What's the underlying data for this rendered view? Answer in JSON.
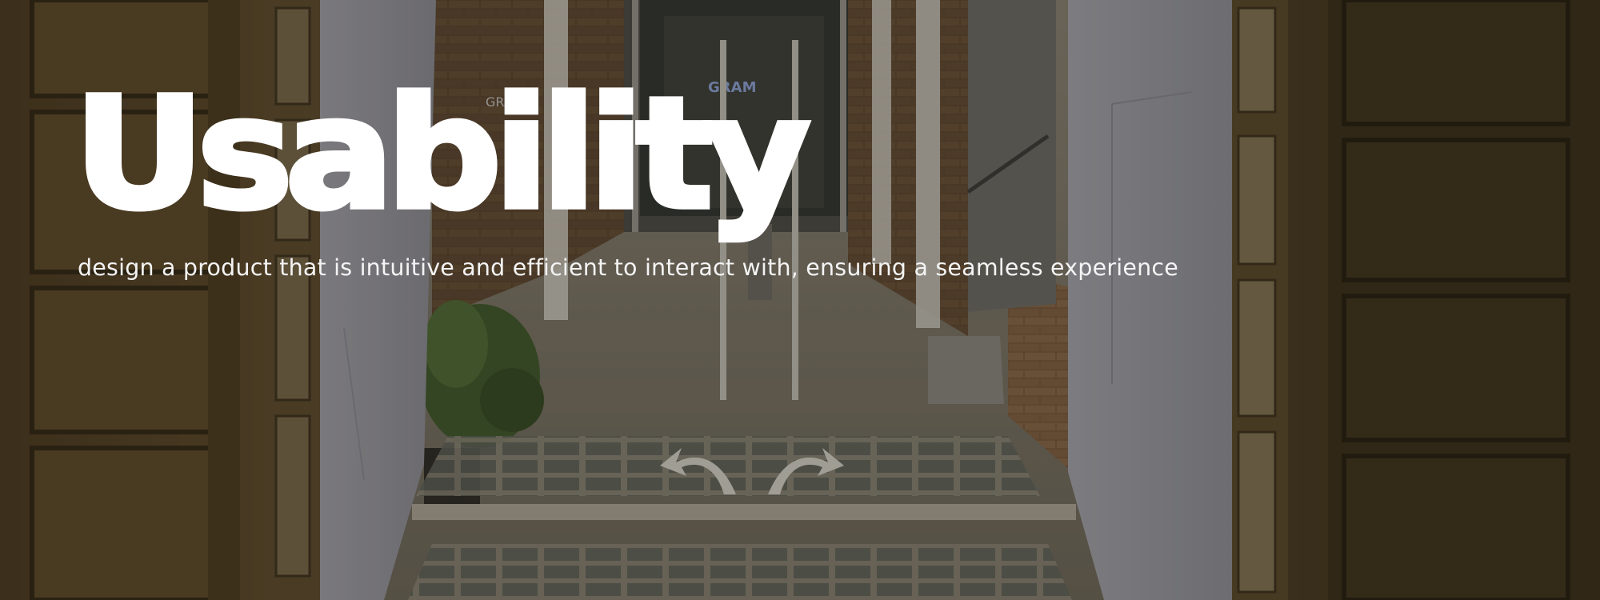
{
  "hero": {
    "title": "Usability",
    "subtitle": "design a product that is intuitive and efficient to interact with, ensuring a seamless experience"
  },
  "background": {
    "description_icon": "corridor-photo",
    "overlay_color": "#1e1a10",
    "wall_color": "#5a4a2c",
    "brick_color": "#7a5a3e",
    "floor_color": "#8a857a",
    "glass_color": "#3a3f3e"
  },
  "photo_text": {
    "sign": "GRAM.",
    "door_sign": "GRAM"
  }
}
